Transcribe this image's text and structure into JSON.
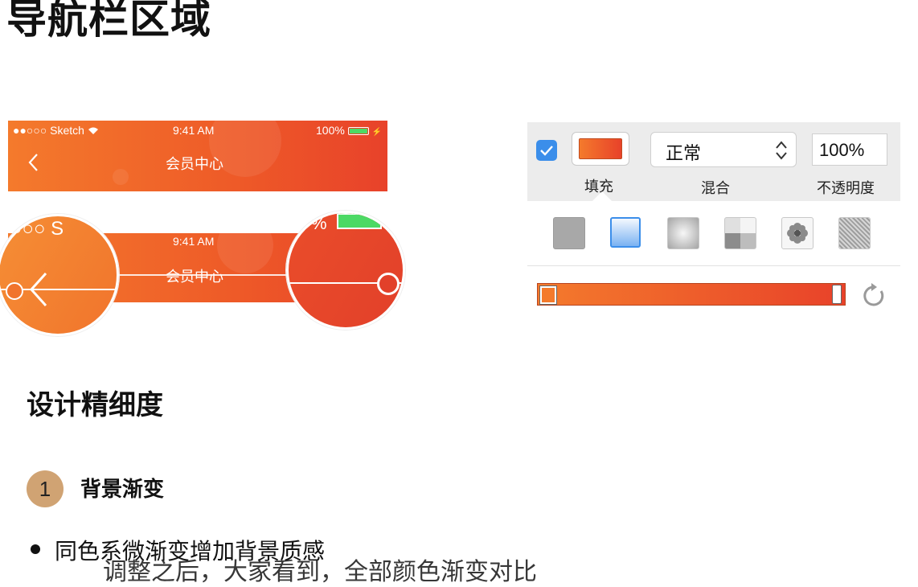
{
  "title": "导航栏区域",
  "status_bar": {
    "carrier": "●●○○○ Sketch",
    "time": "9:41 AM",
    "battery": "100%"
  },
  "navbar": {
    "title": "会员中心",
    "back_icon": "chevron-left-icon"
  },
  "magnifier": {
    "left_text": "○○○ S",
    "right_text": "%"
  },
  "sketch_panel": {
    "fill_color": "#ee5a28",
    "blend_mode": "正常",
    "opacity": "100%",
    "labels": {
      "fill": "填充",
      "blend": "混合",
      "opacity": "不透明度"
    },
    "fill_types": [
      "solid",
      "linear-gradient",
      "radial-gradient",
      "angular-gradient",
      "pattern",
      "noise"
    ],
    "selected_fill_type": "linear-gradient",
    "gradient_start": "#f47a2c",
    "gradient_end": "#e8422a"
  },
  "section": {
    "subtitle": "设计精细度",
    "point_number": "1",
    "point_title": "背景渐变",
    "bullet": "同色系微渐变增加背景质感",
    "caption": "调整之后，大家看到，全部颜色渐变对比"
  }
}
